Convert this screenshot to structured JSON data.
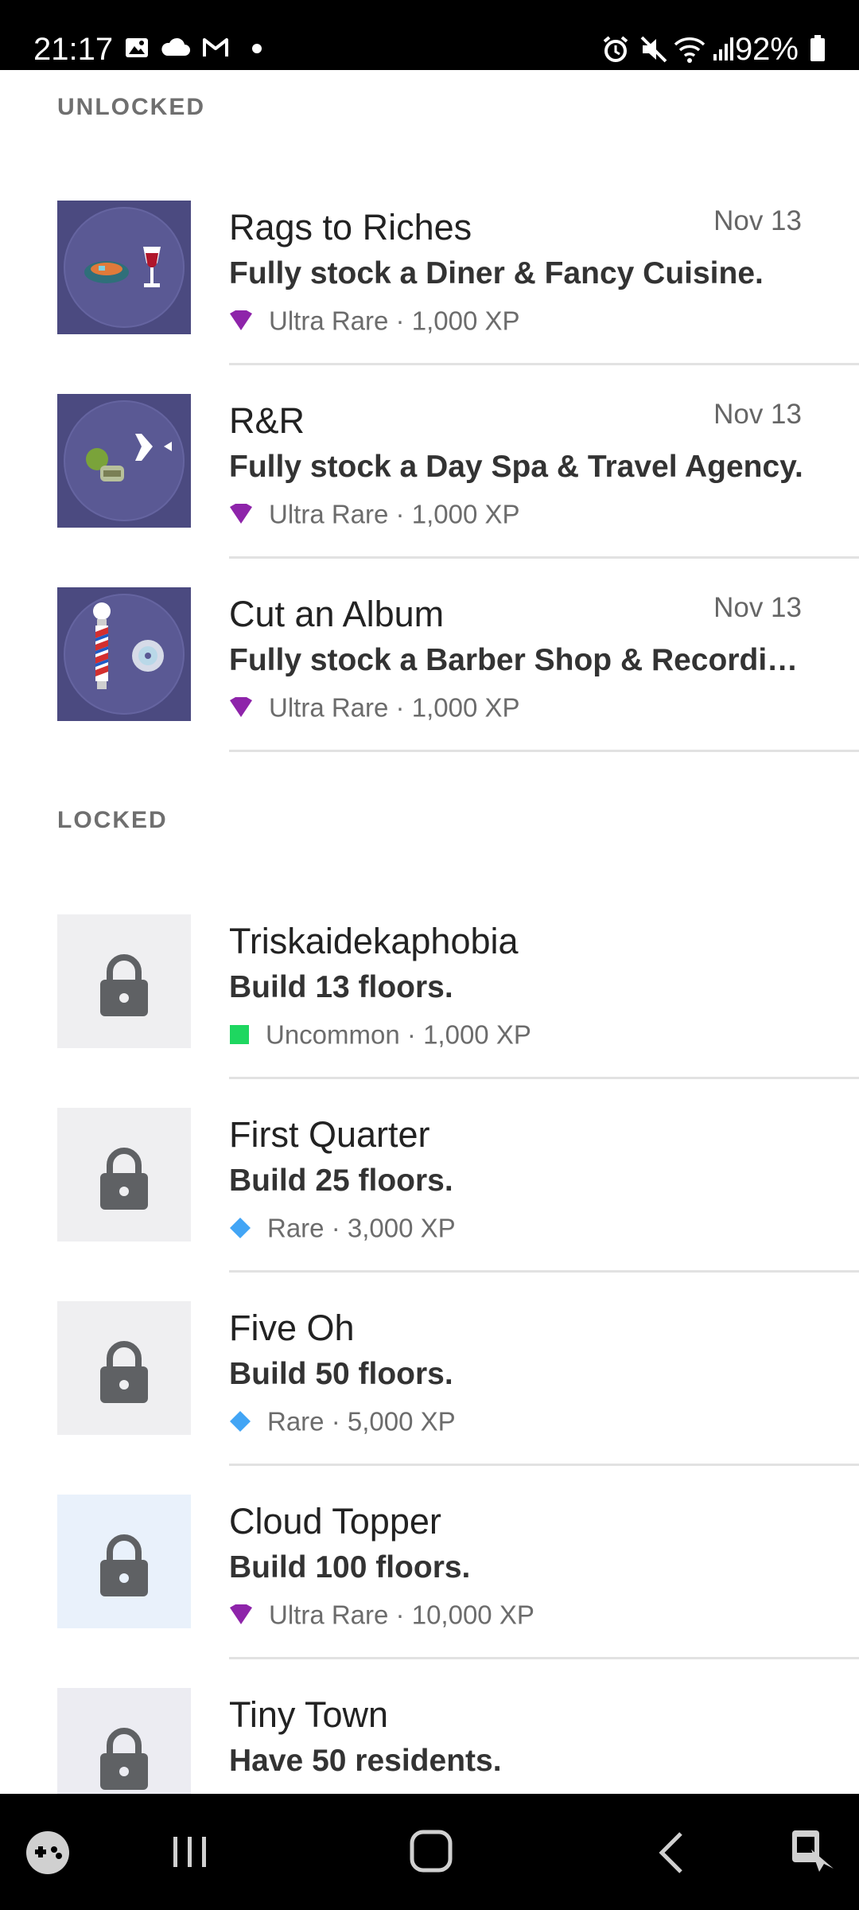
{
  "status_bar": {
    "time": "21:17",
    "battery": "92%",
    "left_icons": [
      "gallery-icon",
      "cloud-icon",
      "gmail-icon",
      "dot-icon"
    ],
    "right_icons": [
      "alarm-icon",
      "mute-icon",
      "wifi-icon",
      "signal-icon",
      "battery-icon"
    ]
  },
  "sections": {
    "unlocked_label": "UNLOCKED",
    "locked_label": "LOCKED"
  },
  "unlocked": [
    {
      "title": "Rags to Riches",
      "date": "Nov 13",
      "desc": "Fully stock a Diner & Fancy Cuisine.",
      "rarity": "Ultra Rare",
      "sep": "·",
      "xp": "1,000 XP",
      "icon": "food-wine-icon"
    },
    {
      "title": "R&R",
      "date": "Nov 13",
      "desc": "Fully stock a Day Spa & Travel Agency.",
      "rarity": "Ultra Rare",
      "sep": "·",
      "xp": "1,000 XP",
      "icon": "spa-plane-icon"
    },
    {
      "title": "Cut an Album",
      "date": "Nov 13",
      "desc": "Fully stock a Barber Shop & Recordi…",
      "rarity": "Ultra Rare",
      "sep": "·",
      "xp": "1,000 XP",
      "icon": "barber-pole-cd-icon"
    }
  ],
  "locked": [
    {
      "title": "Triskaidekaphobia",
      "desc": "Build 13 floors.",
      "rarity": "Uncommon",
      "sep": "·",
      "xp": "1,000 XP"
    },
    {
      "title": "First Quarter",
      "desc": "Build 25 floors.",
      "rarity": "Rare",
      "sep": "·",
      "xp": "3,000 XP"
    },
    {
      "title": "Five Oh",
      "desc": "Build 50 floors.",
      "rarity": "Rare",
      "sep": "·",
      "xp": "5,000 XP"
    },
    {
      "title": "Cloud Topper",
      "desc": "Build 100 floors.",
      "rarity": "Ultra Rare",
      "sep": "·",
      "xp": "10,000 XP"
    },
    {
      "title": "Tiny Town",
      "desc": "Have 50 residents."
    }
  ],
  "colors": {
    "ultra_rare": "#8e24aa",
    "rare": "#42a5f5",
    "uncommon": "#1ed760",
    "thumb_purple": "#4b4a80"
  },
  "nav_bar": {
    "icons": [
      "game-launcher-icon",
      "recents-icon",
      "home-icon",
      "back-icon",
      "assistant-icon"
    ]
  }
}
